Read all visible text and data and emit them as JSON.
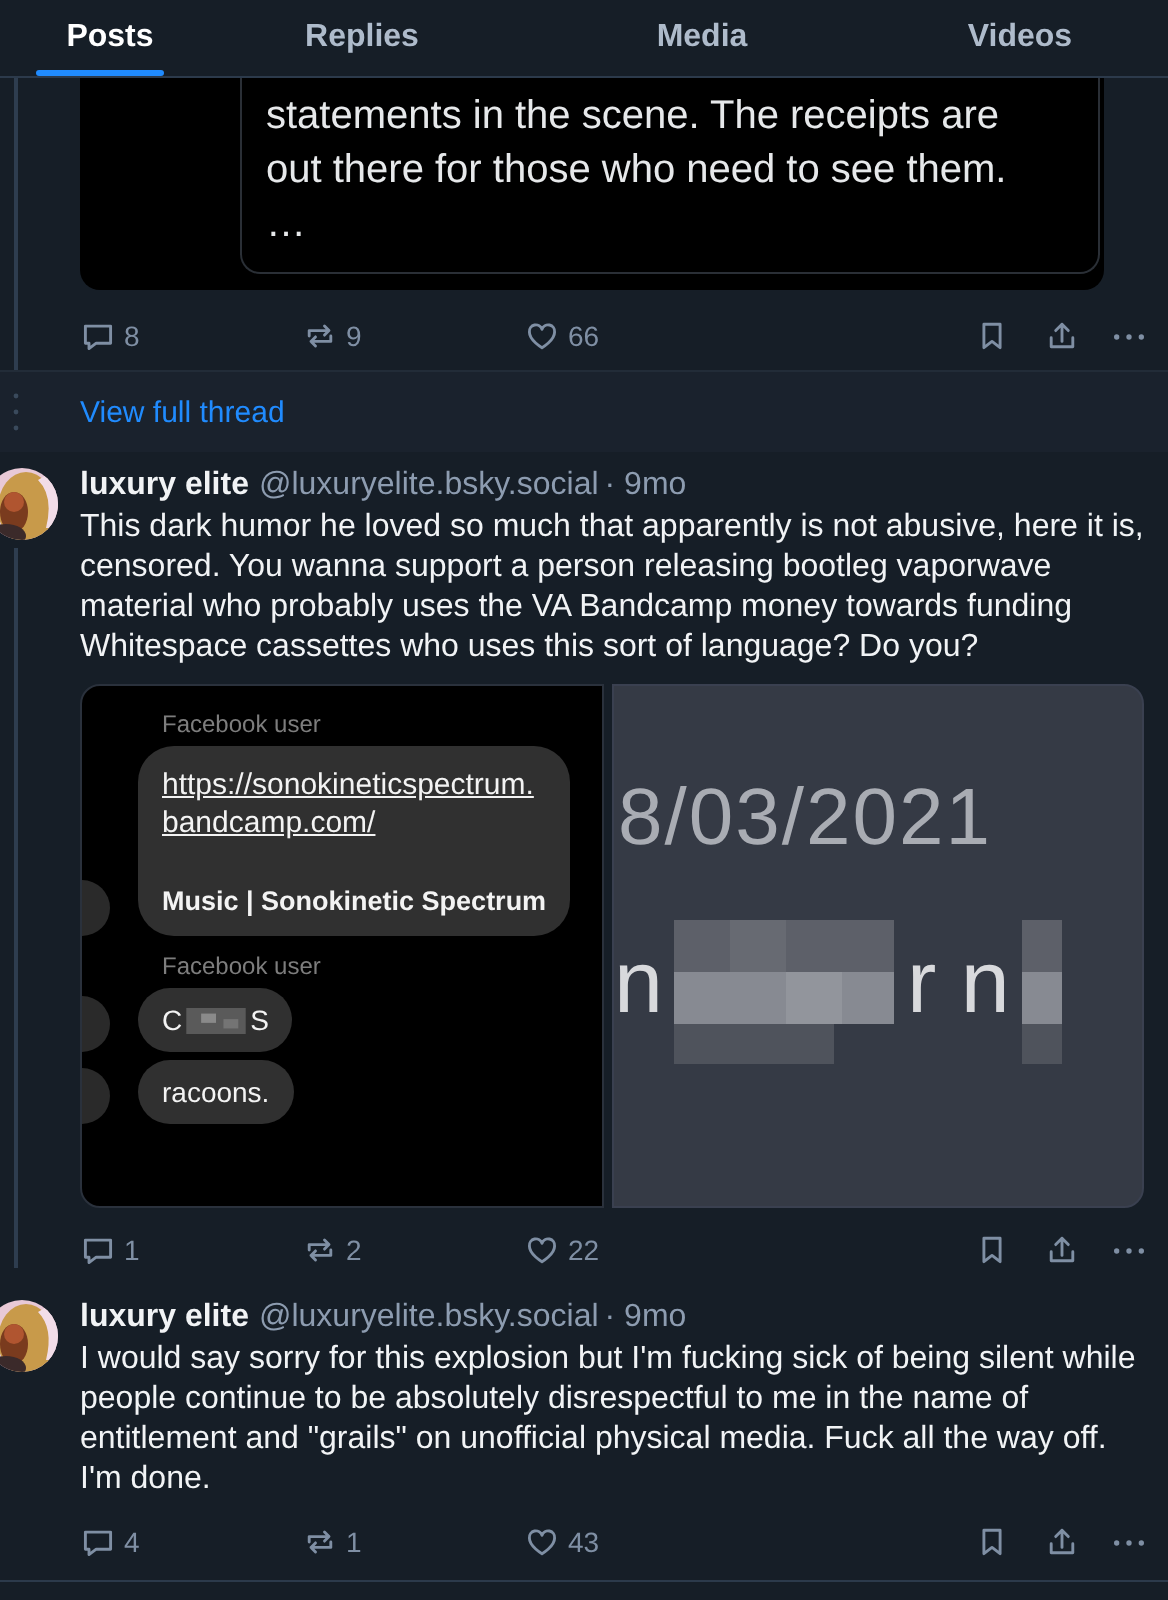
{
  "tabs": [
    {
      "label": "Posts",
      "selected": true
    },
    {
      "label": "Replies",
      "selected": false
    },
    {
      "label": "Media",
      "selected": false
    },
    {
      "label": "Videos",
      "selected": false
    }
  ],
  "top_post": {
    "quote_text": "statements in the scene. The receipts are out there for those who need to see them.",
    "quote_ellipsis": "…",
    "actions": {
      "replies": "8",
      "reposts": "9",
      "likes": "66"
    }
  },
  "view_full_thread": "View full thread",
  "posts": [
    {
      "author": "luxury elite",
      "handle": "@luxuryelite.bsky.social",
      "time": "· 9mo",
      "text": "This dark humor he loved so much that apparently is not abusive, here it is, censored. You wanna support a person releasing bootleg vaporwave material who probably uses the VA Bandcamp money towards funding Whitespace cassettes who uses this sort of language? Do you?",
      "thread_line": true,
      "media": [
        {
          "kind": "chat",
          "messages": [
            {
              "kind": "link",
              "sender": "Facebook user",
              "link": "https://sonokineticspectrum.bandcamp.com/",
              "title": "Music | Sonokinetic Spectrum"
            },
            {
              "kind": "censored",
              "sender": "Facebook user",
              "before": "C",
              "after": "S"
            },
            {
              "kind": "text",
              "text": "racoons."
            }
          ]
        },
        {
          "kind": "blurred",
          "date": "8/03/2021",
          "word_start": "n",
          "word_end": "r n"
        }
      ],
      "actions": {
        "replies": "1",
        "reposts": "2",
        "likes": "22"
      }
    },
    {
      "author": "luxury elite",
      "handle": "@luxuryelite.bsky.social",
      "time": "· 9mo",
      "text": "I would say sorry for this explosion but I'm fucking sick of being silent while people continue to be absolutely disrespectful to me in the name of entitlement and \"grails\" on unofficial physical media. Fuck all the way off. I'm done.",
      "thread_line": false,
      "actions": {
        "replies": "4",
        "reposts": "1",
        "likes": "43"
      }
    }
  ]
}
